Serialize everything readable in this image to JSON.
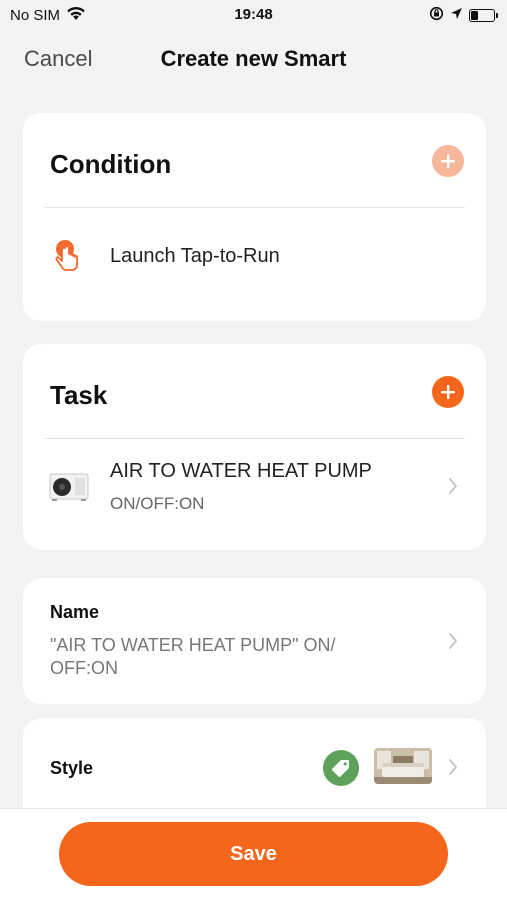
{
  "status_bar": {
    "carrier": "No SIM",
    "time": "19:48",
    "battery_level": 0.3
  },
  "nav": {
    "cancel_label": "Cancel",
    "title": "Create new Smart"
  },
  "condition": {
    "header": "Condition",
    "items": [
      {
        "label": "Launch Tap-to-Run",
        "icon": "tap-hand-icon"
      }
    ]
  },
  "task": {
    "header": "Task",
    "items": [
      {
        "title": "AIR TO WATER HEAT PUMP",
        "subtitle": "ON/OFF:ON",
        "icon": "heat-pump-device-icon"
      }
    ]
  },
  "name": {
    "label": "Name",
    "value": "\"AIR TO WATER HEAT PUMP\" ON/ OFF:ON"
  },
  "style": {
    "label": "Style",
    "tag_color": "#5ea25a"
  },
  "footer": {
    "save_label": "Save"
  },
  "colors": {
    "accent": "#f4661b",
    "accent_faded": "#f7b79a",
    "background": "#f3f3f5"
  }
}
